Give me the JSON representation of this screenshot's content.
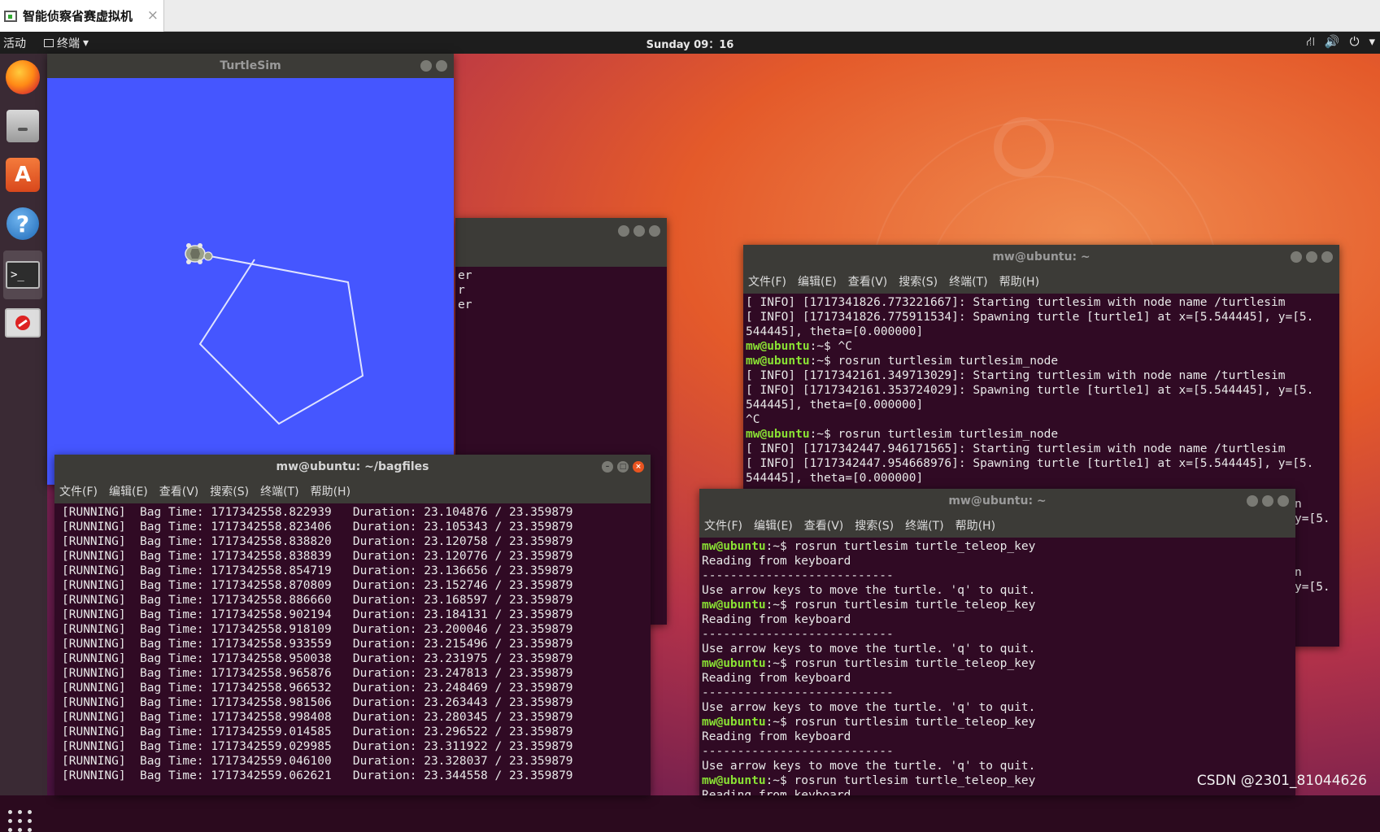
{
  "vm_tab": {
    "title": "智能侦察省赛虚拟机",
    "close": "×"
  },
  "topbar": {
    "activities": "活动",
    "app_menu": "终端",
    "clock": "Sunday 09：16"
  },
  "turtlesim": {
    "title": "TurtleSim"
  },
  "bag_window": {
    "title": "mw@ubuntu: ~/bagfiles",
    "menu": [
      "文件(F)",
      "编辑(E)",
      "查看(V)",
      "搜索(S)",
      "终端(T)",
      "帮助(H)"
    ],
    "lines": [
      "[RUNNING]  Bag Time: 1717342558.822939   Duration: 23.104876 / 23.359879",
      "[RUNNING]  Bag Time: 1717342558.823406   Duration: 23.105343 / 23.359879",
      "[RUNNING]  Bag Time: 1717342558.838820   Duration: 23.120758 / 23.359879",
      "[RUNNING]  Bag Time: 1717342558.838839   Duration: 23.120776 / 23.359879",
      "[RUNNING]  Bag Time: 1717342558.854719   Duration: 23.136656 / 23.359879",
      "[RUNNING]  Bag Time: 1717342558.870809   Duration: 23.152746 / 23.359879",
      "[RUNNING]  Bag Time: 1717342558.886660   Duration: 23.168597 / 23.359879",
      "[RUNNING]  Bag Time: 1717342558.902194   Duration: 23.184131 / 23.359879",
      "[RUNNING]  Bag Time: 1717342558.918109   Duration: 23.200046 / 23.359879",
      "[RUNNING]  Bag Time: 1717342558.933559   Duration: 23.215496 / 23.359879",
      "[RUNNING]  Bag Time: 1717342558.950038   Duration: 23.231975 / 23.359879",
      "[RUNNING]  Bag Time: 1717342558.965876   Duration: 23.247813 / 23.359879",
      "[RUNNING]  Bag Time: 1717342558.966532   Duration: 23.248469 / 23.359879",
      "[RUNNING]  Bag Time: 1717342558.981506   Duration: 23.263443 / 23.359879",
      "[RUNNING]  Bag Time: 1717342558.998408   Duration: 23.280345 / 23.359879",
      "[RUNNING]  Bag Time: 1717342559.014585   Duration: 23.296522 / 23.359879",
      "[RUNNING]  Bag Time: 1717342559.029985   Duration: 23.311922 / 23.359879",
      "[RUNNING]  Bag Time: 1717342559.046100   Duration: 23.328037 / 23.359879",
      "[RUNNING]  Bag Time: 1717342559.062621   Duration: 23.344558 / 23.359879"
    ]
  },
  "partial_window": {
    "lines": [
      "",
      "",
      "",
      "er",
      "r",
      "",
      "",
      "",
      "",
      "",
      "er"
    ]
  },
  "node_window": {
    "title": "mw@ubuntu: ~",
    "menu": [
      "文件(F)",
      "编辑(E)",
      "查看(V)",
      "搜索(S)",
      "终端(T)",
      "帮助(H)"
    ],
    "lines": [
      {
        "t": "[ INFO] [1717341826.773221667]: Starting turtlesim with node name /turtlesim"
      },
      {
        "t": "[ INFO] [1717341826.775911534]: Spawning turtle [turtle1] at x=[5.544445], y=[5."
      },
      {
        "t": "544445], theta=[0.000000]"
      },
      {
        "p": "mw@ubuntu",
        "t": ":~$ ^C"
      },
      {
        "p": "mw@ubuntu",
        "t": ":~$ rosrun turtlesim turtlesim_node"
      },
      {
        "t": "[ INFO] [1717342161.349713029]: Starting turtlesim with node name /turtlesim"
      },
      {
        "t": "[ INFO] [1717342161.353724029]: Spawning turtle [turtle1] at x=[5.544445], y=[5."
      },
      {
        "t": "544445], theta=[0.000000]"
      },
      {
        "t": "^C"
      },
      {
        "p": "mw@ubuntu",
        "t": ":~$ rosrun turtlesim turtlesim_node"
      },
      {
        "t": "[ INFO] [1717342447.946171565]: Starting turtlesim with node name /turtlesim"
      },
      {
        "t": "[ INFO] [1717342447.954668976]: Spawning turtle [turtle1] at x=[5.544445], y=[5."
      },
      {
        "t": "544445], theta=[0.000000]"
      }
    ],
    "edge_fragments": [
      "n",
      "y=[5.",
      "n",
      "y=[5."
    ]
  },
  "teleop_window": {
    "title": "mw@ubuntu: ~",
    "menu": [
      "文件(F)",
      "编辑(E)",
      "查看(V)",
      "搜索(S)",
      "终端(T)",
      "帮助(H)"
    ],
    "lines": [
      {
        "p": "mw@ubuntu",
        "t": ":~$ rosrun turtlesim turtle_teleop_key"
      },
      {
        "t": "Reading from keyboard"
      },
      {
        "t": "---------------------------"
      },
      {
        "t": "Use arrow keys to move the turtle. 'q' to quit."
      },
      {
        "p": "mw@ubuntu",
        "t": ":~$ rosrun turtlesim turtle_teleop_key"
      },
      {
        "t": "Reading from keyboard"
      },
      {
        "t": "---------------------------"
      },
      {
        "t": "Use arrow keys to move the turtle. 'q' to quit."
      },
      {
        "p": "mw@ubuntu",
        "t": ":~$ rosrun turtlesim turtle_teleop_key"
      },
      {
        "t": "Reading from keyboard"
      },
      {
        "t": "---------------------------"
      },
      {
        "t": "Use arrow keys to move the turtle. 'q' to quit."
      },
      {
        "p": "mw@ubuntu",
        "t": ":~$ rosrun turtlesim turtle_teleop_key"
      },
      {
        "t": "Reading from keyboard"
      },
      {
        "t": "---------------------------"
      },
      {
        "t": "Use arrow keys to move the turtle. 'q' to quit."
      },
      {
        "p": "mw@ubuntu",
        "t": ":~$ rosrun turtlesim turtle_teleop_key"
      },
      {
        "t": "Reading from keyboard"
      }
    ]
  },
  "watermark": "CSDN @2301_81044626",
  "colors": {
    "terminal_bg": "#300a24",
    "prompt": "#8ae234",
    "turtlesim_bg": "#4556ff",
    "accent": "#e95420"
  },
  "icons": [
    "firefox-icon",
    "files-icon",
    "software-store-icon",
    "help-icon",
    "terminal-icon",
    "no-entry-icon",
    "app-grid-icon",
    "network-icon",
    "volume-icon",
    "power-icon"
  ]
}
